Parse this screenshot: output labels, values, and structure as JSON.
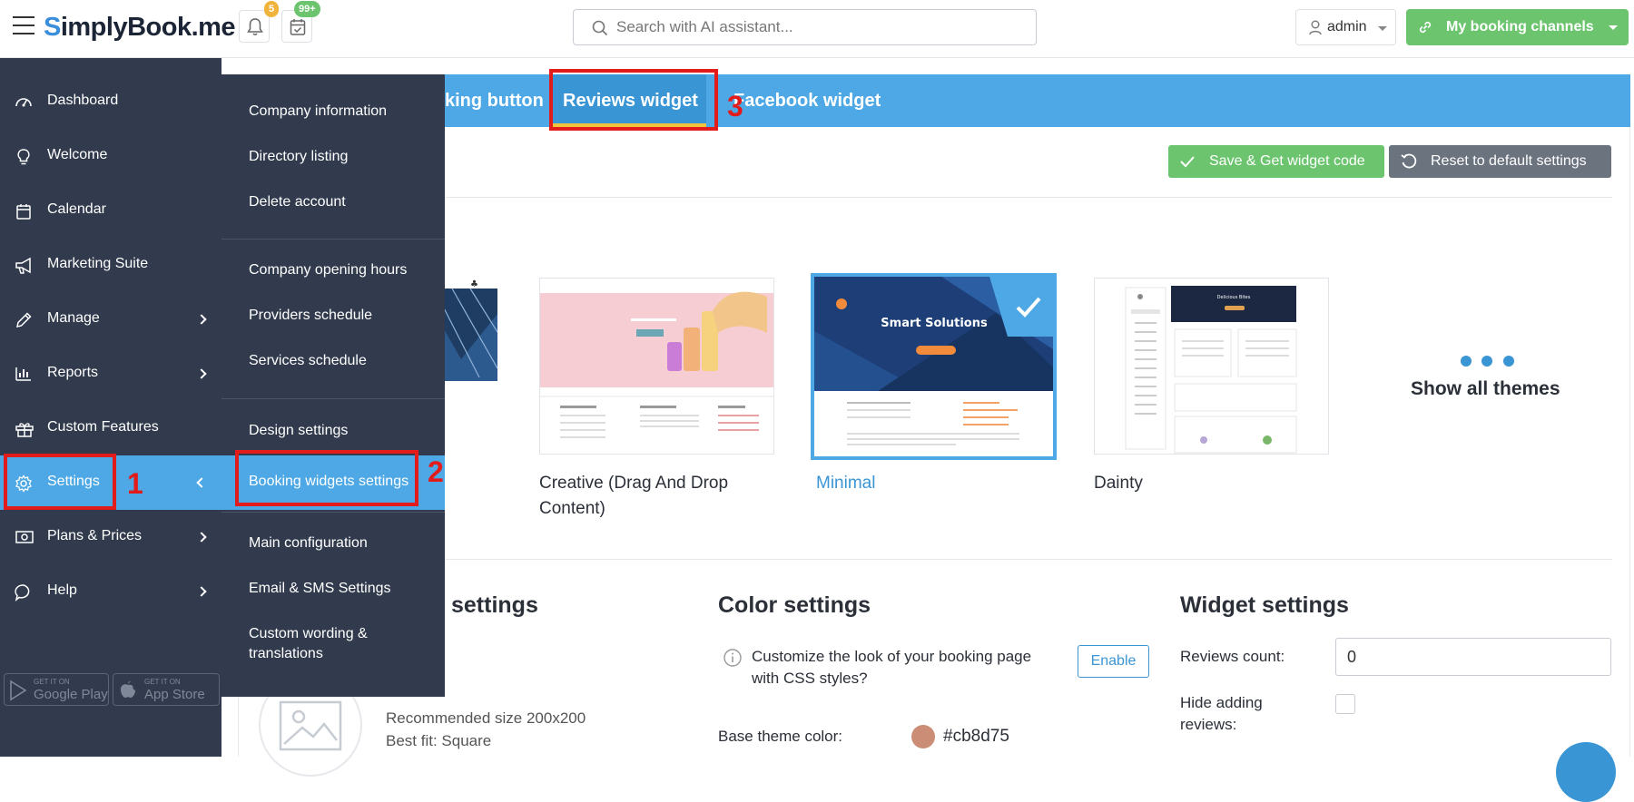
{
  "header": {
    "logo_prefix": "S",
    "logo_text": "implyBook.me",
    "notifications_badge": "5",
    "bookings_badge": "99+",
    "search_placeholder": "Search with AI assistant...",
    "user_label": "admin",
    "channels_label": "My booking channels",
    "colors": {
      "accent": "#4da8e5",
      "green": "#6cc56e",
      "sidebar": "#313b4d"
    }
  },
  "sidebar": {
    "items": [
      {
        "label": "Dashboard",
        "icon": "dashboard-icon"
      },
      {
        "label": "Welcome",
        "icon": "lightbulb-icon"
      },
      {
        "label": "Calendar",
        "icon": "calendar-icon"
      },
      {
        "label": "Marketing Suite",
        "icon": "megaphone-icon"
      },
      {
        "label": "Manage",
        "icon": "pencil-icon"
      },
      {
        "label": "Reports",
        "icon": "bar-chart-icon"
      },
      {
        "label": "Custom Features",
        "icon": "gift-icon"
      },
      {
        "label": "Settings",
        "icon": "gear-icon"
      },
      {
        "label": "Plans & Prices",
        "icon": "money-icon"
      },
      {
        "label": "Help",
        "icon": "chat-icon"
      }
    ],
    "google_small": "GET IT ON",
    "google_big": "Google Play",
    "apple_small": "GET IT ON",
    "apple_big": "App Store"
  },
  "submenu": {
    "items": [
      "Company information",
      "Directory listing",
      "Delete account",
      "Company opening hours",
      "Providers schedule",
      "Services schedule",
      "Design settings",
      "Booking widgets settings",
      "Main configuration",
      "Email & SMS Settings",
      "Custom wording &",
      "translations"
    ]
  },
  "tabs": {
    "booking_button": "king button",
    "reviews_widget": "Reviews widget",
    "facebook_widget": "Facebook widget"
  },
  "actions": {
    "save_label": "Save & Get widget code",
    "reset_label": "Reset to default settings"
  },
  "themes": {
    "creative_line1": "Creative (Drag And Drop",
    "creative_line2": "Content)",
    "minimal": "Minimal",
    "dainty": "Dainty",
    "show_all": "Show all themes",
    "minimal_preview_title": "Smart Solutions",
    "dainty_preview_title": "Delicious Bites"
  },
  "sections": {
    "image_settings_title": "settings",
    "image_rec_size": "Recommended size 200x200",
    "image_best_fit": "Best fit: Square",
    "color_settings_title": "Color settings",
    "css_line1": "Customize the look of your booking page",
    "css_line2": "with CSS styles?",
    "enable_label": "Enable",
    "base_color_label": "Base theme color:",
    "base_color_value": "#cb8d75",
    "widget_settings_title": "Widget settings",
    "reviews_count_label": "Reviews count:",
    "reviews_count_value": "0",
    "hide_adding_line1": "Hide adding",
    "hide_adding_line2": "reviews:"
  },
  "annotations": {
    "step1": "1",
    "step2": "2",
    "step3": "3"
  }
}
